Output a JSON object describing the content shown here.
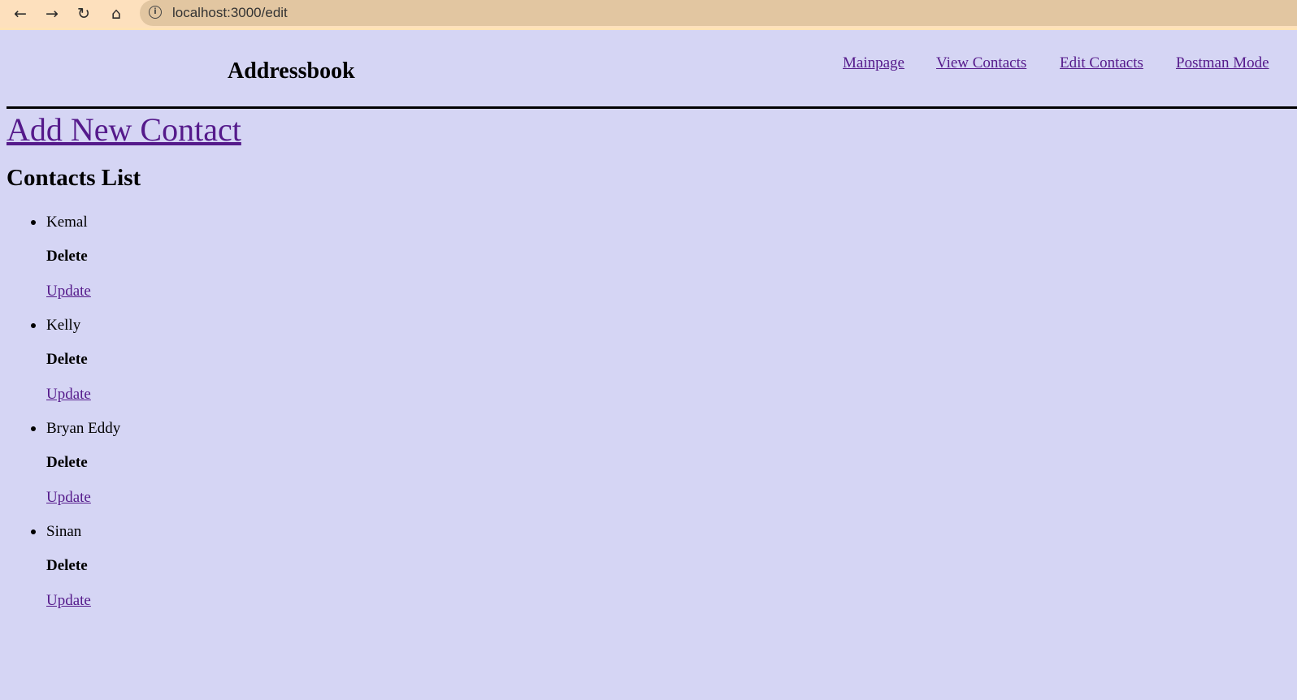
{
  "browser": {
    "url": "localhost:3000/edit",
    "icons": [
      "back-icon",
      "forward-icon",
      "reload-icon",
      "home-icon",
      "info-icon"
    ]
  },
  "header": {
    "brand": "Addressbook",
    "nav": [
      "Mainpage",
      "View Contacts",
      "Edit Contacts",
      "Postman Mode"
    ]
  },
  "main": {
    "add_link": "Add New Contact",
    "list_title": "Contacts List",
    "contacts": [
      {
        "name": "Kemal",
        "delete": "Delete",
        "update": "Update"
      },
      {
        "name": "Kelly",
        "delete": "Delete",
        "update": "Update"
      },
      {
        "name": "Bryan Eddy",
        "delete": "Delete",
        "update": "Update"
      },
      {
        "name": "Sinan",
        "delete": "Delete",
        "update": "Update"
      }
    ]
  },
  "colors": {
    "background": "#d5d5f4",
    "link": "#551a8b",
    "toolbar": "#fde0bd"
  }
}
